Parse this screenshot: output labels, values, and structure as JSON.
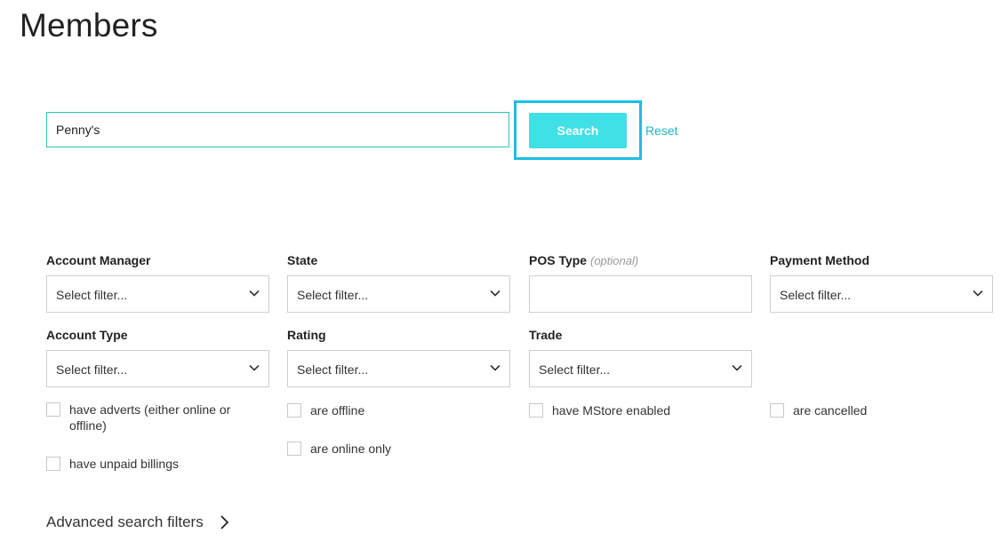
{
  "page": {
    "title": "Members"
  },
  "search": {
    "value": "Penny's",
    "button_label": "Search",
    "reset_label": "Reset"
  },
  "filters": {
    "account_manager": {
      "label": "Account Manager",
      "value": "Select filter..."
    },
    "state": {
      "label": "State",
      "value": "Select filter..."
    },
    "pos_type": {
      "label": "POS Type",
      "optional_label": "(optional)",
      "value": ""
    },
    "payment_method": {
      "label": "Payment Method",
      "value": "Select filter..."
    },
    "account_type": {
      "label": "Account Type",
      "value": "Select filter..."
    },
    "rating": {
      "label": "Rating",
      "value": "Select filter..."
    },
    "trade": {
      "label": "Trade",
      "value": "Select filter..."
    }
  },
  "checkboxes": {
    "have_adverts": "have adverts (either online or offline)",
    "have_unpaid_billings": "have unpaid billings",
    "are_offline": "are offline",
    "are_online_only": "are online only",
    "have_mstore_enabled": "have MStore enabled",
    "are_cancelled": "are cancelled"
  },
  "advanced": {
    "label": "Advanced search filters"
  },
  "icons": {
    "dropdown": "chevron-down-icon",
    "advanced": "chevron-right-icon"
  },
  "colors": {
    "accent": "#3fe0e6",
    "focus_ring": "#1cbfe0",
    "link": "#1ab8c4",
    "input_border": "#2bc4c4"
  }
}
